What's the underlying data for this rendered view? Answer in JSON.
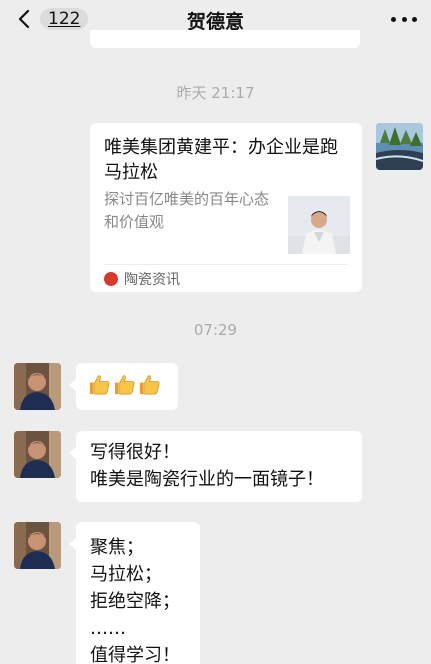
{
  "header": {
    "unread_count": "122",
    "title": "贺德意"
  },
  "messages": {
    "timestamp_1": "昨天 21:17",
    "card": {
      "title": "唯美集团黄建平：办企业是跑马拉松",
      "description": "探讨百亿唯美的百年心态和价值观",
      "source": "陶瓷资讯"
    },
    "timestamp_2": "07:29",
    "msg2": {
      "line1": "写得很好！",
      "line2": "唯美是陶瓷行业的一面镜子！"
    },
    "msg3": {
      "line1": "聚焦；",
      "line2": "马拉松；",
      "line3": "拒绝空降；",
      "line4": "……",
      "line5": "值得学习！"
    }
  },
  "icons": {
    "back": "chevron-left-icon",
    "more": "more-dots-icon",
    "thumbs": "thumbs-up-emoji"
  },
  "colors": {
    "background": "#ededed",
    "bubble": "#ffffff",
    "source_logo": "#d53c2f",
    "timestamp": "#aaaaaa"
  }
}
